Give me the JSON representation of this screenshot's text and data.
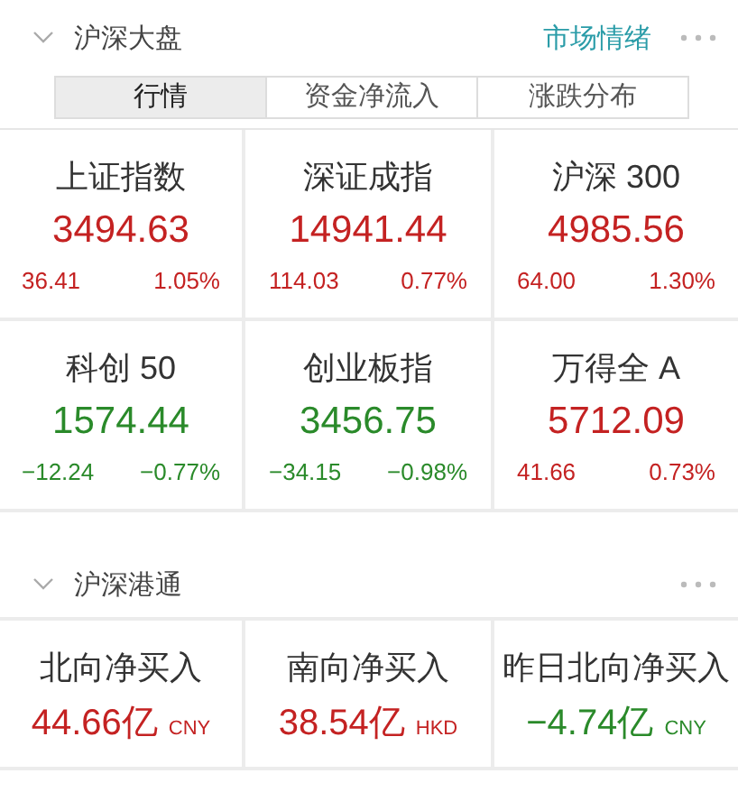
{
  "market_section": {
    "title": "沪深大盘",
    "expanded": true,
    "link": "市场情绪",
    "tabs": [
      {
        "label": "行情",
        "selected": true
      },
      {
        "label": "资金净流入",
        "selected": false
      },
      {
        "label": "涨跌分布",
        "selected": false
      }
    ],
    "indices": [
      {
        "name": "上证指数",
        "value": "3494.63",
        "change": "36.41",
        "percent": "1.05%",
        "color": "#c42222"
      },
      {
        "name": "深证成指",
        "value": "14941.44",
        "change": "114.03",
        "percent": "0.77%",
        "color": "#c42222"
      },
      {
        "name": "沪深 300",
        "value": "4985.56",
        "change": "64.00",
        "percent": "1.30%",
        "color": "#c42222"
      },
      {
        "name": "科创 50",
        "value": "1574.44",
        "change": "−12.24",
        "percent": "−0.77%",
        "color": "#2a8a2a"
      },
      {
        "name": "创业板指",
        "value": "3456.75",
        "change": "−34.15",
        "percent": "−0.98%",
        "color": "#2a8a2a"
      },
      {
        "name": "万得全 A",
        "value": "5712.09",
        "change": "41.66",
        "percent": "0.73%",
        "color": "#c42222"
      }
    ]
  },
  "connect_section": {
    "title": "沪深港通",
    "expanded": true,
    "flows": [
      {
        "name": "北向净买入",
        "value": "44.66亿",
        "currency": "CNY",
        "color": "#c42222"
      },
      {
        "name": "南向净买入",
        "value": "38.54亿",
        "currency": "HKD",
        "color": "#c42222"
      },
      {
        "name": "昨日北向净买入",
        "value": "−4.74亿",
        "currency": "CNY",
        "color": "#2a8a2a"
      }
    ]
  }
}
